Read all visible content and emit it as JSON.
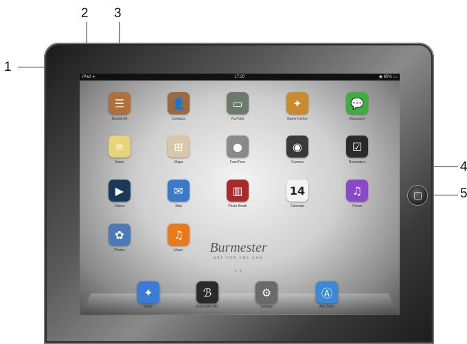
{
  "callouts": [
    "1",
    "2",
    "3",
    "4",
    "5"
  ],
  "status_bar": {
    "carrier": "iPad ᯤ",
    "time": "17:20",
    "battery": "◉ 85% ▭"
  },
  "apps": [
    {
      "name": "bookshelf",
      "label": "Bookshelf",
      "glyph": "☰",
      "color": "#b0703a"
    },
    {
      "name": "contacts",
      "label": "Contacts",
      "glyph": "👤",
      "color": "#9c6a3c"
    },
    {
      "name": "youtube",
      "label": "YouTube",
      "glyph": "▭",
      "color": "#6b7a6b"
    },
    {
      "name": "game-center",
      "label": "Game Center",
      "glyph": "✦",
      "color": "#c98a30"
    },
    {
      "name": "messages",
      "label": "Messages",
      "glyph": "💬",
      "color": "#3fae3f"
    },
    {
      "name": "notes",
      "label": "Notes",
      "glyph": "≡",
      "color": "#e8d27a"
    },
    {
      "name": "maps",
      "label": "Maps",
      "glyph": "⊞",
      "color": "#d8c8a8"
    },
    {
      "name": "facetime",
      "label": "FaceTime",
      "glyph": "●",
      "color": "#8a8a8a"
    },
    {
      "name": "camera",
      "label": "Camera",
      "glyph": "◉",
      "color": "#3a3a3a"
    },
    {
      "name": "reminders",
      "label": "Reminders",
      "glyph": "☑",
      "color": "#2a2a2a"
    },
    {
      "name": "videos",
      "label": "Videos",
      "glyph": "▶",
      "color": "#1a3a5a"
    },
    {
      "name": "mail",
      "label": "Mail",
      "glyph": "✉",
      "color": "#3a7ac8"
    },
    {
      "name": "photo-booth",
      "label": "Photo Booth",
      "glyph": "▥",
      "color": "#a82a2a"
    },
    {
      "name": "calendar",
      "label": "Calendar",
      "glyph": "14",
      "color": "#f4f4f4"
    },
    {
      "name": "itunes",
      "label": "iTunes",
      "glyph": "♫",
      "color": "#8a4ac8"
    },
    {
      "name": "photos",
      "label": "Photos",
      "glyph": "✿",
      "color": "#4a7ab8"
    },
    {
      "name": "music",
      "label": "Music",
      "glyph": "♫",
      "color": "#e87a1a"
    }
  ],
  "watermark": {
    "main": "Burmester",
    "tag": "ART FOR THE EAR"
  },
  "page_dots": "• •",
  "dock": [
    {
      "name": "safari",
      "label": "Safari",
      "glyph": "✦",
      "color": "#3a7ad8"
    },
    {
      "name": "burmester-mc",
      "label": "Burmester MC",
      "glyph": "ℬ",
      "color": "#2a2a2a"
    },
    {
      "name": "settings",
      "label": "Settings",
      "glyph": "⚙",
      "color": "#6a6a6a"
    },
    {
      "name": "app-store",
      "label": "App Store",
      "glyph": "Ⓐ",
      "color": "#3a8ad8"
    }
  ]
}
